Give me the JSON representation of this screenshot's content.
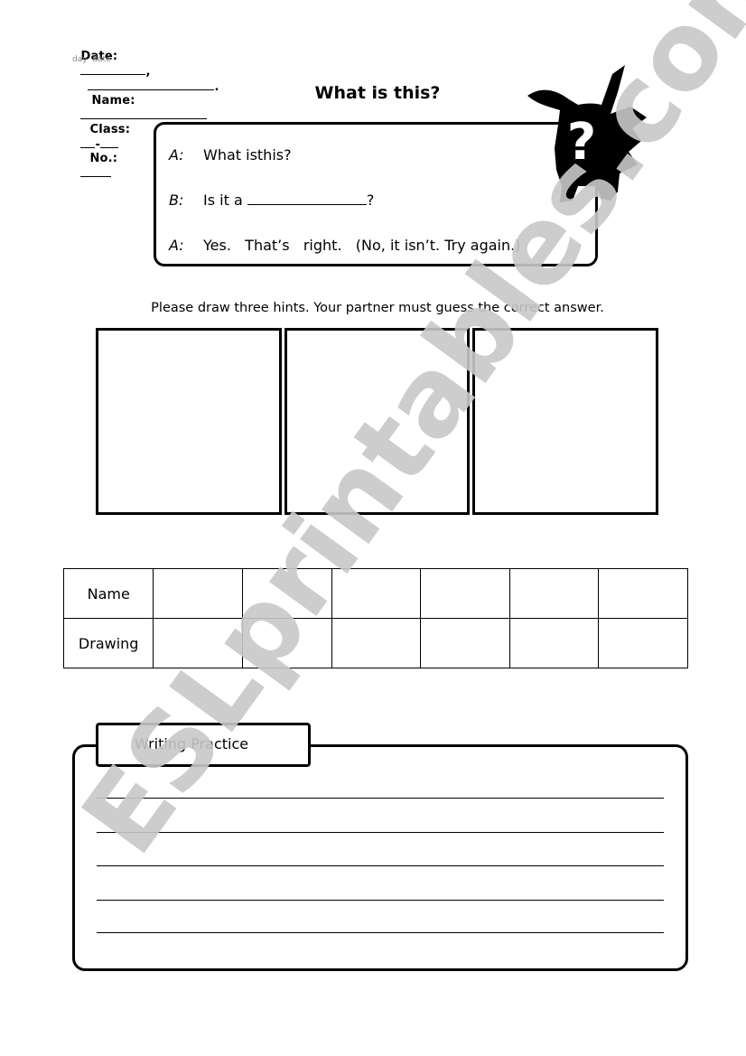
{
  "header": {
    "date_label": "Date:",
    "name_label": "Name:",
    "class_label": "Class:",
    "class_separator": "-",
    "number_label": "No.:",
    "comma": ",",
    "period": ".",
    "day_hint": "day",
    "date_hint": "date"
  },
  "title": "What is this?",
  "dialogue": [
    {
      "speaker": "A:",
      "text": "What isthis?"
    },
    {
      "speaker": "B:",
      "text_before": "Is it a ",
      "text_after": "?"
    },
    {
      "speaker": "A:",
      "text": "Yes.   That’s   right.   (No, it isn’t. Try again.)"
    }
  ],
  "illustration": {
    "icon": "pikachu-silhouette-question-icon",
    "glyph": "?"
  },
  "instruction": "Please draw three hints. Your partner must guess the correct answer.",
  "hint_boxes": 3,
  "names_table": {
    "rows": [
      {
        "label": "Name",
        "cells": [
          "",
          "",
          "",
          "",
          "",
          ""
        ]
      },
      {
        "label": "Drawing",
        "cells": [
          "",
          "",
          "",
          "",
          "",
          ""
        ]
      }
    ]
  },
  "writing_practice": {
    "label": "Writing Practice",
    "line_count": 5
  },
  "watermark": "ESLprintables.com"
}
